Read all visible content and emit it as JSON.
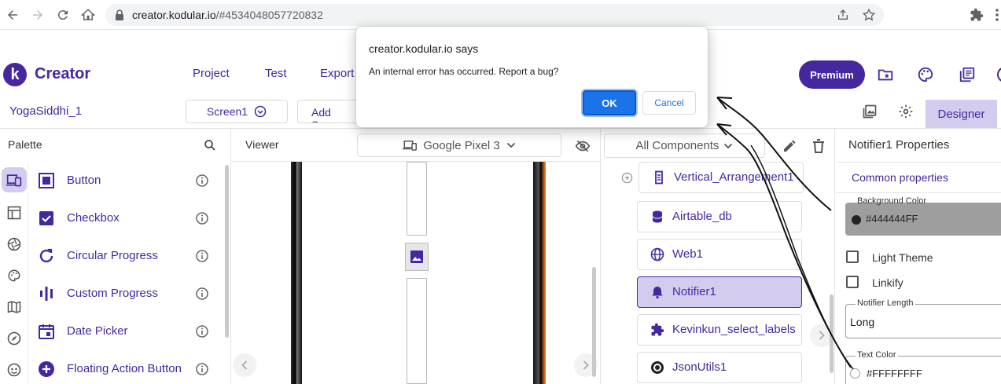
{
  "browser": {
    "url_host": "creator.kodular.io",
    "url_rest": "/#4534048057720832",
    "icons": [
      "back-icon",
      "forward-icon",
      "reload-icon",
      "home-icon",
      "lock-icon",
      "share-icon",
      "star-icon",
      "extensions-icon"
    ]
  },
  "app": {
    "logo_letter": "k",
    "title": "Creator",
    "menu": [
      "Project",
      "Test",
      "Export"
    ],
    "premium_label": "Premium",
    "accent_color": "#4527a0",
    "selected_color": "#d4ccef"
  },
  "toolbar": {
    "project_name": "YogaSiddhi_1",
    "screen": "Screen1",
    "add_screen": "Add Screen",
    "designer_label": "Designer"
  },
  "palette": {
    "title": "Palette",
    "categories": [
      "devices-icon",
      "table-icon",
      "aperture-icon",
      "palette-icon",
      "map-icon",
      "compass-icon",
      "face-icon"
    ],
    "items": [
      {
        "label": "Button",
        "icon": "button-icon"
      },
      {
        "label": "Checkbox",
        "icon": "checkbox-icon"
      },
      {
        "label": "Circular Progress",
        "icon": "circular-progress-icon"
      },
      {
        "label": "Custom Progress",
        "icon": "custom-progress-icon"
      },
      {
        "label": "Date Picker",
        "icon": "date-picker-icon"
      },
      {
        "label": "Floating Action Button",
        "icon": "fab-icon"
      }
    ]
  },
  "viewer": {
    "title": "Viewer",
    "device": "Google Pixel 3"
  },
  "components": {
    "filter": "All Components",
    "items": [
      {
        "label": "Vertical_Arrangement1",
        "icon": "vertical-arrangement-icon",
        "selected": false
      },
      {
        "label": "Airtable_db",
        "icon": "database-icon",
        "selected": false
      },
      {
        "label": "Web1",
        "icon": "globe-icon",
        "selected": false
      },
      {
        "label": "Notifier1",
        "icon": "bell-icon",
        "selected": true
      },
      {
        "label": "Kevinkun_select_labels",
        "icon": "puzzle-icon",
        "selected": false
      },
      {
        "label": "JsonUtils1",
        "icon": "json-icon",
        "selected": false
      }
    ]
  },
  "properties": {
    "title": "Notifier1 Properties",
    "tab": "Common properties",
    "background_color_label": "Background Color",
    "background_color_value": "#444444FF",
    "light_theme_label": "Light Theme",
    "linkify_label": "Linkify",
    "notifier_length_label": "Notifier Length",
    "notifier_length_value": "Long",
    "text_color_label": "Text Color",
    "text_color_value": "#FFFFFFFF"
  },
  "dialog": {
    "title": "creator.kodular.io says",
    "message": "An internal error has occurred. Report a bug?",
    "ok_label": "OK",
    "cancel_label": "Cancel"
  }
}
